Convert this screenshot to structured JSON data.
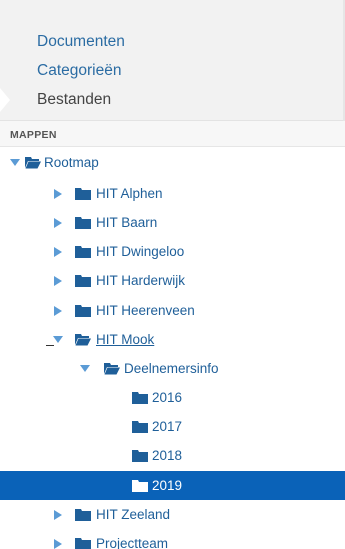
{
  "nav": {
    "items": [
      {
        "label": "Documenten",
        "active": false
      },
      {
        "label": "Categorieën",
        "active": false
      },
      {
        "label": "Bestanden",
        "active": true
      }
    ]
  },
  "section": {
    "title": "MAPPEN"
  },
  "tree": [
    {
      "label": "Rootmap",
      "level": 0,
      "expanded": true,
      "open_folder": true
    },
    {
      "label": "HIT Alphen",
      "level": 1,
      "expanded": false
    },
    {
      "label": "HIT Baarn",
      "level": 1,
      "expanded": false
    },
    {
      "label": "HIT Dwingeloo",
      "level": 1,
      "expanded": false
    },
    {
      "label": "HIT Harderwijk",
      "level": 1,
      "expanded": false
    },
    {
      "label": "HIT Heerenveen",
      "level": 1,
      "expanded": false
    },
    {
      "label": "HIT Mook",
      "level": 1,
      "expanded": true,
      "open_folder": true
    },
    {
      "label": "Deelnemersinfo",
      "level": 2,
      "expanded": true,
      "open_folder": true
    },
    {
      "label": "2016",
      "level": 3
    },
    {
      "label": "2017",
      "level": 3
    },
    {
      "label": "2018",
      "level": 3
    },
    {
      "label": "2019",
      "level": 3,
      "selected": true
    },
    {
      "label": "HIT Zeeland",
      "level": 1,
      "expanded": false
    },
    {
      "label": "Projectteam",
      "level": 1,
      "expanded": false
    }
  ],
  "colors": {
    "link": "#1f5f99",
    "selected_bg": "#0a62b8",
    "icon": "#1f5f99"
  }
}
